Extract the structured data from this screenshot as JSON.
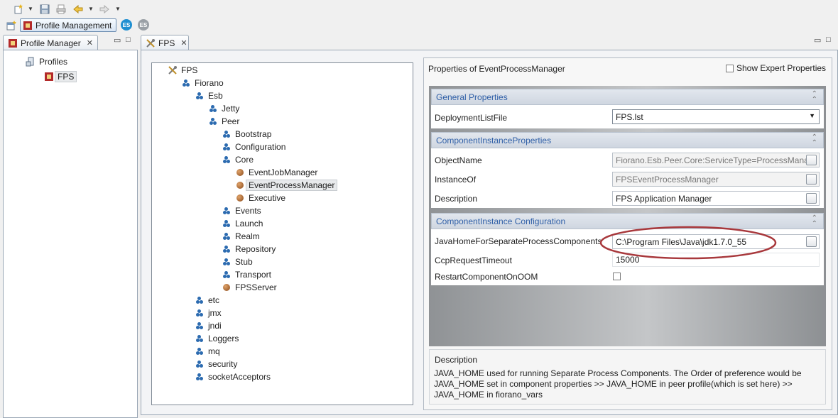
{
  "toolbar": {
    "perspective_label": "Profile Management",
    "badges": [
      "ES",
      "ES"
    ]
  },
  "profile_manager": {
    "tab_label": "Profile Manager",
    "tree": [
      {
        "label": "Profiles",
        "icon": "server-icon"
      },
      {
        "label": "FPS",
        "icon": "profile-icon",
        "selected": true
      }
    ]
  },
  "editor": {
    "tab_label": "FPS",
    "tree": [
      {
        "label": "FPS",
        "depth": 0,
        "icon": "tools-icon"
      },
      {
        "label": "Fiorano",
        "depth": 1,
        "icon": "package-icon"
      },
      {
        "label": "Esb",
        "depth": 2,
        "icon": "package-icon"
      },
      {
        "label": "Jetty",
        "depth": 3,
        "icon": "package-icon"
      },
      {
        "label": "Peer",
        "depth": 3,
        "icon": "package-icon"
      },
      {
        "label": "Bootstrap",
        "depth": 4,
        "icon": "package-icon"
      },
      {
        "label": "Configuration",
        "depth": 4,
        "icon": "package-icon"
      },
      {
        "label": "Core",
        "depth": 4,
        "icon": "package-icon"
      },
      {
        "label": "EventJobManager",
        "depth": 5,
        "icon": "bean-icon"
      },
      {
        "label": "EventProcessManager",
        "depth": 5,
        "icon": "bean-icon",
        "selected": true
      },
      {
        "label": "Executive",
        "depth": 5,
        "icon": "bean-icon"
      },
      {
        "label": "Events",
        "depth": 4,
        "icon": "package-icon"
      },
      {
        "label": "Launch",
        "depth": 4,
        "icon": "package-icon"
      },
      {
        "label": "Realm",
        "depth": 4,
        "icon": "package-icon"
      },
      {
        "label": "Repository",
        "depth": 4,
        "icon": "package-icon"
      },
      {
        "label": "Stub",
        "depth": 4,
        "icon": "package-icon"
      },
      {
        "label": "Transport",
        "depth": 4,
        "icon": "package-icon"
      },
      {
        "label": "FPSServer",
        "depth": 4,
        "icon": "bean-icon"
      },
      {
        "label": "etc",
        "depth": 2,
        "icon": "package-icon"
      },
      {
        "label": "jmx",
        "depth": 2,
        "icon": "package-icon"
      },
      {
        "label": "jndi",
        "depth": 2,
        "icon": "package-icon"
      },
      {
        "label": "Loggers",
        "depth": 2,
        "icon": "package-icon"
      },
      {
        "label": "mq",
        "depth": 2,
        "icon": "package-icon"
      },
      {
        "label": "security",
        "depth": 2,
        "icon": "package-icon"
      },
      {
        "label": "socketAcceptors",
        "depth": 2,
        "icon": "package-icon"
      }
    ]
  },
  "properties": {
    "title": "Properties of EventProcessManager",
    "show_expert_label": "Show Expert Properties",
    "general_title": "General Properties",
    "deployment_label": "DeploymentListFile",
    "deployment_value": "FPS.lst",
    "instance_props_title": "ComponentInstanceProperties",
    "objectname_label": "ObjectName",
    "objectname_value": "Fiorano.Esb.Peer.Core:ServiceType=ProcessManag",
    "instanceof_label": "InstanceOf",
    "instanceof_value": "FPSEventProcessManager",
    "description_label": "Description",
    "description_value": "FPS Application Manager",
    "instance_config_title": "ComponentInstance Configuration",
    "javahome_label": "JavaHomeForSeparateProcessComponents",
    "javahome_value": "C:\\Program Files\\Java\\jdk1.7.0_55",
    "ccp_label": "CcpRequestTimeout",
    "ccp_value": "15000",
    "restart_label": "RestartComponentOnOOM",
    "help_title": "Description",
    "help_text": "JAVA_HOME used for running Separate Process Components. The Order of preference would be JAVA_HOME set in component properties >> JAVA_HOME in peer profile(which is set here) >> JAVA_HOME in fiorano_vars"
  },
  "colors": {
    "section_title": "#2f5fa7",
    "highlight_ellipse": "#a8383c"
  }
}
